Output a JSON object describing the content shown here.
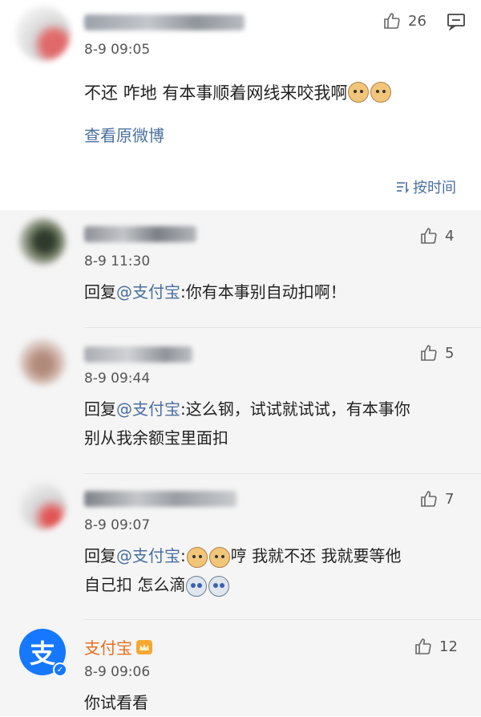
{
  "main_comment": {
    "time": "8-9 09:05",
    "likes": "26",
    "text": "不还 咋地 有本事顺着网线来咬我啊",
    "view_original": "查看原微博",
    "sort_label": "按时间"
  },
  "replies": [
    {
      "time": "8-9 11:30",
      "likes": "4",
      "prefix": "回复",
      "mention": "@支付宝",
      "text": ":你有本事别自动扣啊！"
    },
    {
      "time": "8-9 09:44",
      "likes": "5",
      "prefix": "回复",
      "mention": "@支付宝",
      "text": ":这么钢，试试就试试，有本事你",
      "text2": "别从我余额宝里面扣"
    },
    {
      "time": "8-9 09:07",
      "likes": "7",
      "prefix": "回复",
      "mention": "@支付宝",
      "text": "哼 我就不还  我就要等他",
      "text2": "自己扣 怎么滴"
    },
    {
      "author": "支付宝",
      "time": "8-9 09:06",
      "likes": "12",
      "text": "你试看看"
    }
  ],
  "colors": {
    "link": "#4a6fa0",
    "alipay_blue": "#1677ff",
    "reply_bg": "#f5f5f5"
  }
}
